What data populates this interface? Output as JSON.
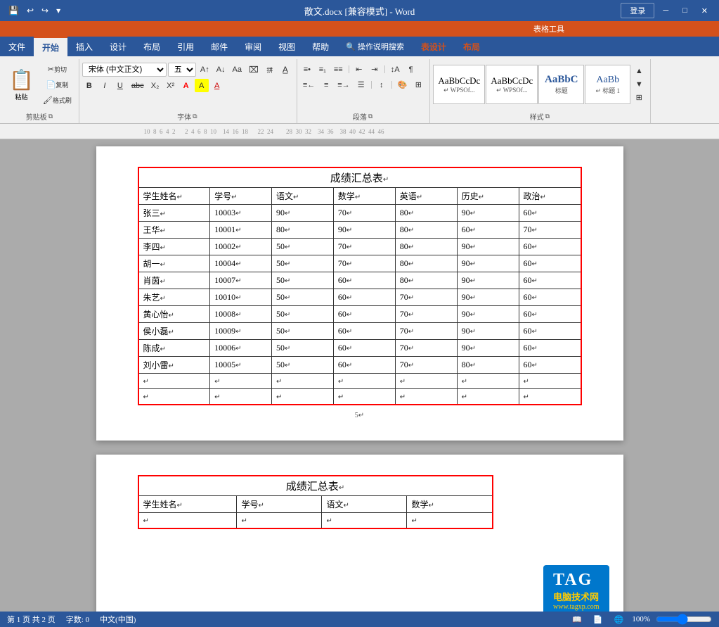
{
  "titleBar": {
    "document_name": "散文.docx [兼容模式] - Word",
    "app_name": "Word",
    "table_tools": "表格工具",
    "login_label": "登录"
  },
  "ribbon": {
    "tabs": [
      {
        "id": "file",
        "label": "文件"
      },
      {
        "id": "home",
        "label": "开始",
        "active": true
      },
      {
        "id": "insert",
        "label": "插入"
      },
      {
        "id": "design",
        "label": "设计"
      },
      {
        "id": "layout",
        "label": "布局"
      },
      {
        "id": "references",
        "label": "引用"
      },
      {
        "id": "mail",
        "label": "邮件"
      },
      {
        "id": "review",
        "label": "审阅"
      },
      {
        "id": "view",
        "label": "视图"
      },
      {
        "id": "help",
        "label": "帮助"
      },
      {
        "id": "search",
        "label": "🔍 操作说明搜索"
      },
      {
        "id": "tabledesign",
        "label": "表设计",
        "context": true
      },
      {
        "id": "tablelayout",
        "label": "布局",
        "context": true
      }
    ],
    "clipboard": {
      "label": "剪贴板",
      "paste_label": "粘贴",
      "cut_label": "剪切",
      "copy_label": "复制",
      "format_painter_label": "格式刷"
    },
    "font": {
      "label": "字体",
      "font_name": "宋体 (中文正文)",
      "font_size": "五号",
      "bold": "B",
      "italic": "I",
      "underline": "U",
      "strikethrough": "abc",
      "subscript": "X₂",
      "superscript": "X²",
      "font_color_label": "A",
      "highlight_label": "A"
    },
    "paragraph": {
      "label": "段落"
    },
    "styles": {
      "label": "样式",
      "items": [
        {
          "id": "normal",
          "label": "AaBbCcDc",
          "sublabel": "↵ WPSOf..."
        },
        {
          "id": "normal2",
          "label": "AaBbCcDc",
          "sublabel": "↵ WPSOf..."
        },
        {
          "id": "heading1",
          "label": "AaBbC",
          "sublabel": "标题"
        },
        {
          "id": "heading2",
          "label": "AaBb",
          "sublabel": "↵ 标题 1"
        }
      ]
    }
  },
  "page1": {
    "table": {
      "title": "成绩汇总表",
      "headers": [
        "学生姓名",
        "学号",
        "语文",
        "数学",
        "英语",
        "历史",
        "政治"
      ],
      "rows": [
        {
          "name": "张三",
          "id": "10003",
          "chinese": "90",
          "math": "70",
          "english": "80",
          "history": "90",
          "politics": "60"
        },
        {
          "name": "王华",
          "id": "10001",
          "chinese": "80",
          "math": "90",
          "english": "80",
          "history": "60",
          "politics": "70"
        },
        {
          "name": "李四",
          "id": "10002",
          "chinese": "50",
          "math": "70",
          "english": "80",
          "history": "90",
          "politics": "60"
        },
        {
          "name": "胡一",
          "id": "10004",
          "chinese": "50",
          "math": "70",
          "english": "80",
          "history": "90",
          "politics": "60"
        },
        {
          "name": "肖茵",
          "id": "10007",
          "chinese": "50",
          "math": "60",
          "english": "80",
          "history": "90",
          "politics": "60"
        },
        {
          "name": "朱艺",
          "id": "10010",
          "chinese": "50",
          "math": "60",
          "english": "70",
          "history": "90",
          "politics": "60"
        },
        {
          "name": "黄心怡",
          "id": "10008",
          "chinese": "50",
          "math": "60",
          "english": "70",
          "history": "90",
          "politics": "60"
        },
        {
          "name": "侯小磊",
          "id": "10009",
          "chinese": "50",
          "math": "60",
          "english": "70",
          "history": "90",
          "politics": "60"
        },
        {
          "name": "陈成",
          "id": "10006",
          "chinese": "50",
          "math": "60",
          "english": "70",
          "history": "90",
          "politics": "60"
        },
        {
          "name": "刘小雷",
          "id": "10005",
          "chinese": "50",
          "math": "60",
          "english": "70",
          "history": "80",
          "politics": "60"
        }
      ]
    }
  },
  "page2": {
    "table": {
      "title": "成绩汇总表",
      "headers": [
        "学生姓名",
        "学号",
        "语文",
        "数学"
      ]
    }
  },
  "statusBar": {
    "pages": "第 1 页 共 2 页",
    "words": "字数: 0",
    "language": "中文(中国)",
    "zoom": "100%"
  },
  "tag": {
    "label": "TAG",
    "subtitle": "电脑技术网",
    "url": "www.tagxp.com"
  }
}
